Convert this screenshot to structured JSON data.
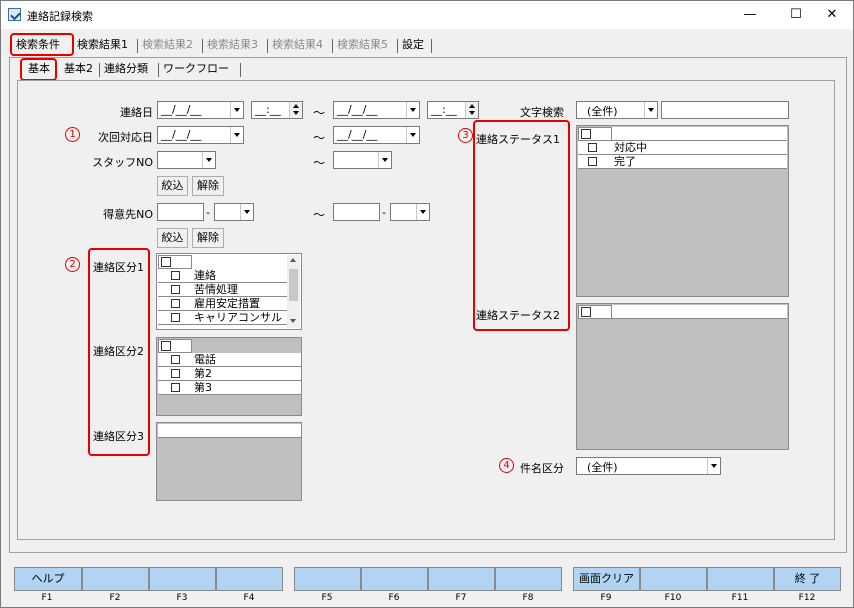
{
  "window": {
    "title": "連絡記録検索",
    "min": "—",
    "max": "☐",
    "close": "✕"
  },
  "tabs": [
    "検索条件",
    "検索結果1",
    "検索結果2",
    "検索結果3",
    "検索結果4",
    "検索結果5",
    "設定"
  ],
  "subtabs": [
    "基本",
    "基本2",
    "連絡分類",
    "ワークフロー"
  ],
  "form": {
    "renraku_bi": "連絡日",
    "jikai_taiou_bi": "次回対応日",
    "staff_no": "スタッフNO",
    "tokuisaki_no": "得意先NO",
    "date_placeholder": "__/__/__",
    "time_placeholder": "__:__",
    "tilde": "～",
    "dash": "-",
    "narrow_btn": "絞込",
    "clear_btn": "解除",
    "moji_kensaku": "文字検索",
    "moji_kensaku_value": "(全件)",
    "kenmei_kubun": "件名区分",
    "kenmei_kubun_value": "(全件)"
  },
  "annotations": {
    "c1": "1",
    "c2": "2",
    "c3": "3",
    "c4": "4"
  },
  "renraku_kubun1": {
    "label": "連絡区分1",
    "items": [
      "連絡",
      "苦情処理",
      "雇用安定措置",
      "キャリアコンサル"
    ]
  },
  "renraku_kubun2": {
    "label": "連絡区分2",
    "items": [
      "電話",
      "第2",
      "第3"
    ]
  },
  "renraku_kubun3": {
    "label": "連絡区分3"
  },
  "status1": {
    "label": "連絡ステータス1",
    "items": [
      "対応中",
      "完了"
    ]
  },
  "status2": {
    "label": "連絡ステータス2"
  },
  "fkeys": [
    {
      "label": "ヘルプ",
      "key": "F1"
    },
    {
      "label": "",
      "key": "F2"
    },
    {
      "label": "",
      "key": "F3"
    },
    {
      "label": "",
      "key": "F4"
    },
    {
      "label": "",
      "key": "F5"
    },
    {
      "label": "",
      "key": "F6"
    },
    {
      "label": "",
      "key": "F7"
    },
    {
      "label": "",
      "key": "F8"
    },
    {
      "label": "画面クリア",
      "key": "F9"
    },
    {
      "label": "",
      "key": "F10"
    },
    {
      "label": "",
      "key": "F11"
    },
    {
      "label": "終 了",
      "key": "F12"
    }
  ],
  "colors": {
    "accent_red": "#e60000",
    "fkey_bg": "#b0d4f1",
    "list_bg": "#c0c0c0"
  }
}
